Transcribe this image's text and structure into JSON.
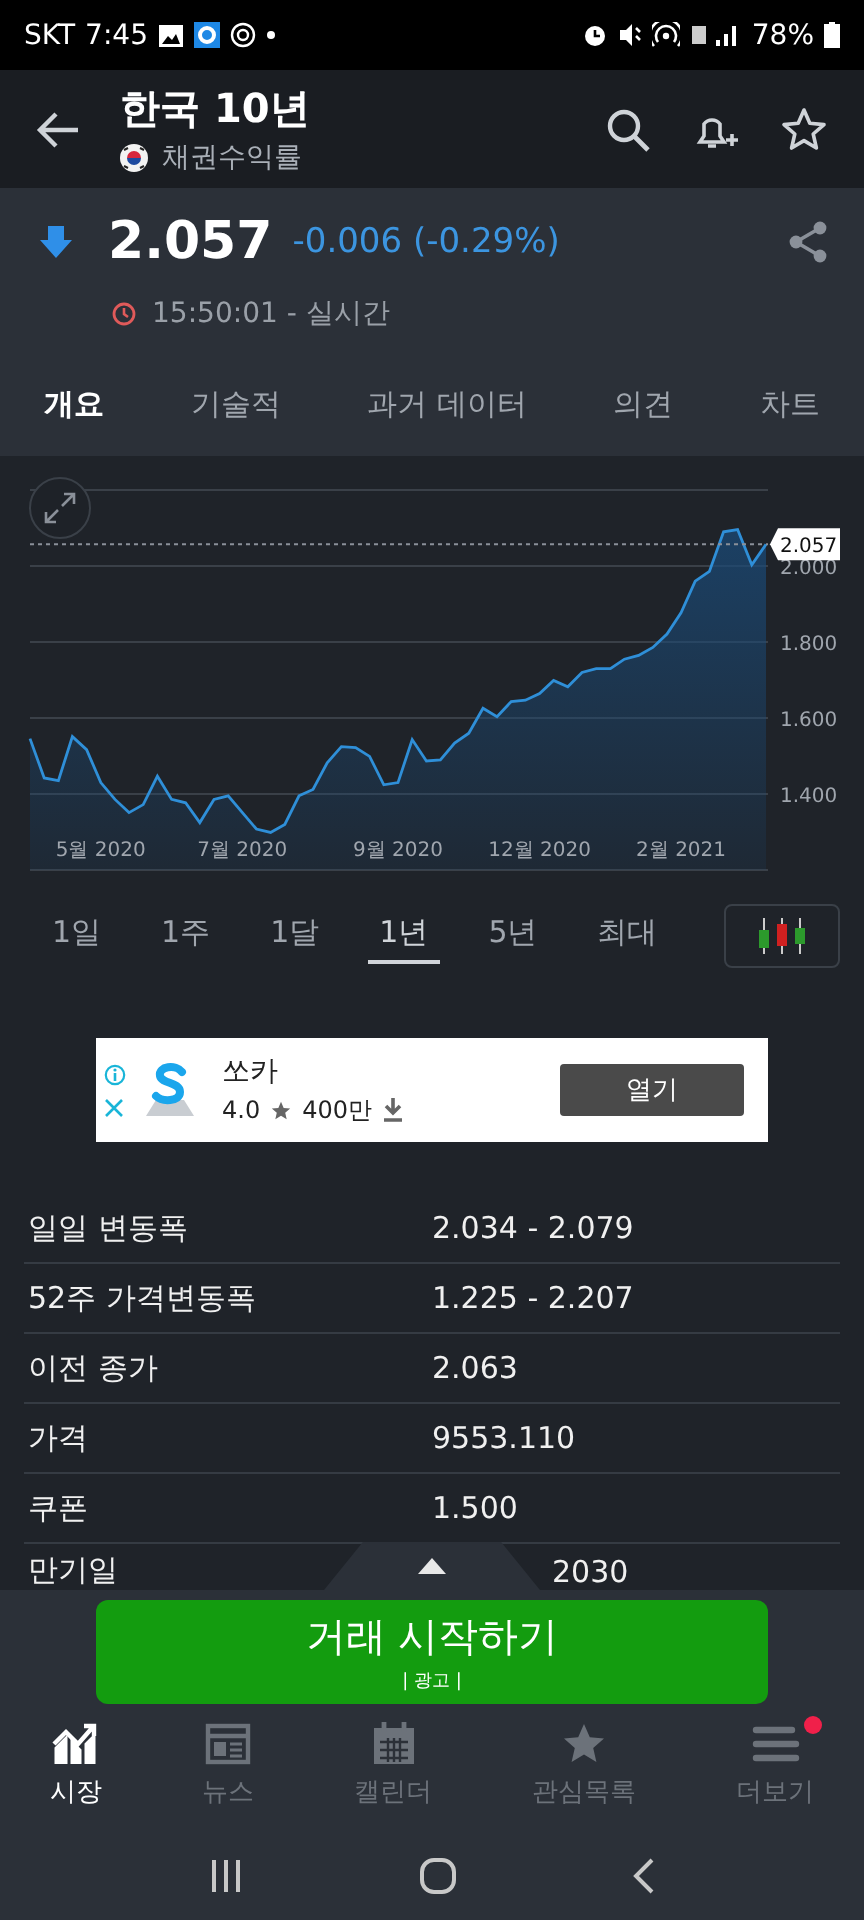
{
  "status_bar": {
    "carrier": "SKT",
    "time": "7:45",
    "battery": "78%"
  },
  "header": {
    "title": "한국 10년",
    "subtitle": "채권수익률"
  },
  "quote": {
    "price": "2.057",
    "change": "-0.006 (-0.29%)",
    "down": true,
    "time": "15:50:01 - 실시간"
  },
  "tabs": [
    {
      "label": "개요",
      "selected": true
    },
    {
      "label": "기술적",
      "selected": false
    },
    {
      "label": "과거 데이터",
      "selected": false
    },
    {
      "label": "의견",
      "selected": false
    },
    {
      "label": "차트",
      "selected": false
    }
  ],
  "chart": {
    "chart_data": {
      "type": "area",
      "categories": [
        null,
        null,
        null,
        null,
        null,
        "5월 2020",
        null,
        null,
        null,
        null,
        null,
        null,
        null,
        null,
        null,
        "7월 2020",
        null,
        null,
        null,
        null,
        null,
        null,
        null,
        null,
        null,
        null,
        "9월 2020",
        null,
        null,
        null,
        null,
        null,
        null,
        null,
        null,
        null,
        "12월 2020",
        null,
        null,
        null,
        null,
        null,
        null,
        null,
        null,
        null,
        "2월 2021",
        null,
        null,
        null,
        null,
        null,
        null
      ],
      "series": [
        {
          "color": "#2f8fd8",
          "values": [
            1.546,
            1.442,
            1.435,
            1.551,
            1.517,
            1.43,
            1.386,
            1.351,
            1.372,
            1.447,
            1.386,
            1.377,
            1.325,
            1.386,
            1.395,
            1.351,
            1.308,
            1.299,
            1.32,
            1.395,
            1.412,
            1.482,
            1.525,
            1.522,
            1.499,
            1.424,
            1.43,
            1.543,
            1.487,
            1.49,
            1.534,
            1.56,
            1.626,
            1.603,
            1.643,
            1.647,
            1.664,
            1.699,
            1.682,
            1.72,
            1.73,
            1.73,
            1.755,
            1.765,
            1.786,
            1.821,
            1.877,
            1.96,
            1.986,
            2.09,
            2.096,
            2.003,
            2.057
          ]
        }
      ],
      "yticks": [
        {
          "value": 1.4,
          "label": "1.400"
        },
        {
          "value": 1.6,
          "label": "1.600"
        },
        {
          "value": 1.8,
          "label": "1.800"
        },
        {
          "value": 2.0,
          "label": "2.000"
        }
      ],
      "ylim": [
        1.2,
        2.2
      ],
      "grid": true,
      "ref_lines": [
        {
          "axis": "y",
          "value": 2.057,
          "label": "2.057"
        }
      ]
    }
  },
  "ranges": [
    {
      "label": "1일",
      "selected": false
    },
    {
      "label": "1주",
      "selected": false
    },
    {
      "label": "1달",
      "selected": false
    },
    {
      "label": "1년",
      "selected": true
    },
    {
      "label": "5년",
      "selected": false
    },
    {
      "label": "최대",
      "selected": false
    }
  ],
  "ad": {
    "app_name": "쏘카",
    "rating": "4.0",
    "downloads": "400만",
    "button": "열기"
  },
  "stats": [
    {
      "label": "일일 변동폭",
      "value": "2.034 - 2.079",
      "kind": "full"
    },
    {
      "label": "52주 가격변동폭",
      "value": "1.225 - 2.207",
      "kind": "full"
    },
    {
      "label": "이전 종가",
      "value": "2.063",
      "kind": "full"
    },
    {
      "label": "가격",
      "value": "9553.110",
      "kind": "full"
    },
    {
      "label": "쿠폰",
      "value": "1.500",
      "kind": "full"
    },
    {
      "label": "만기일",
      "value": "2030",
      "kind": "partial"
    }
  ],
  "cta": {
    "label": "거래 시작하기",
    "note": "| 광고 |"
  },
  "bottom_nav": [
    {
      "label": "시장",
      "selected": true,
      "badge": false
    },
    {
      "label": "뉴스",
      "selected": false,
      "badge": false
    },
    {
      "label": "캘린더",
      "selected": false,
      "badge": false
    },
    {
      "label": "관심목록",
      "selected": false,
      "badge": false
    },
    {
      "label": "더보기",
      "selected": false,
      "badge": true
    }
  ]
}
